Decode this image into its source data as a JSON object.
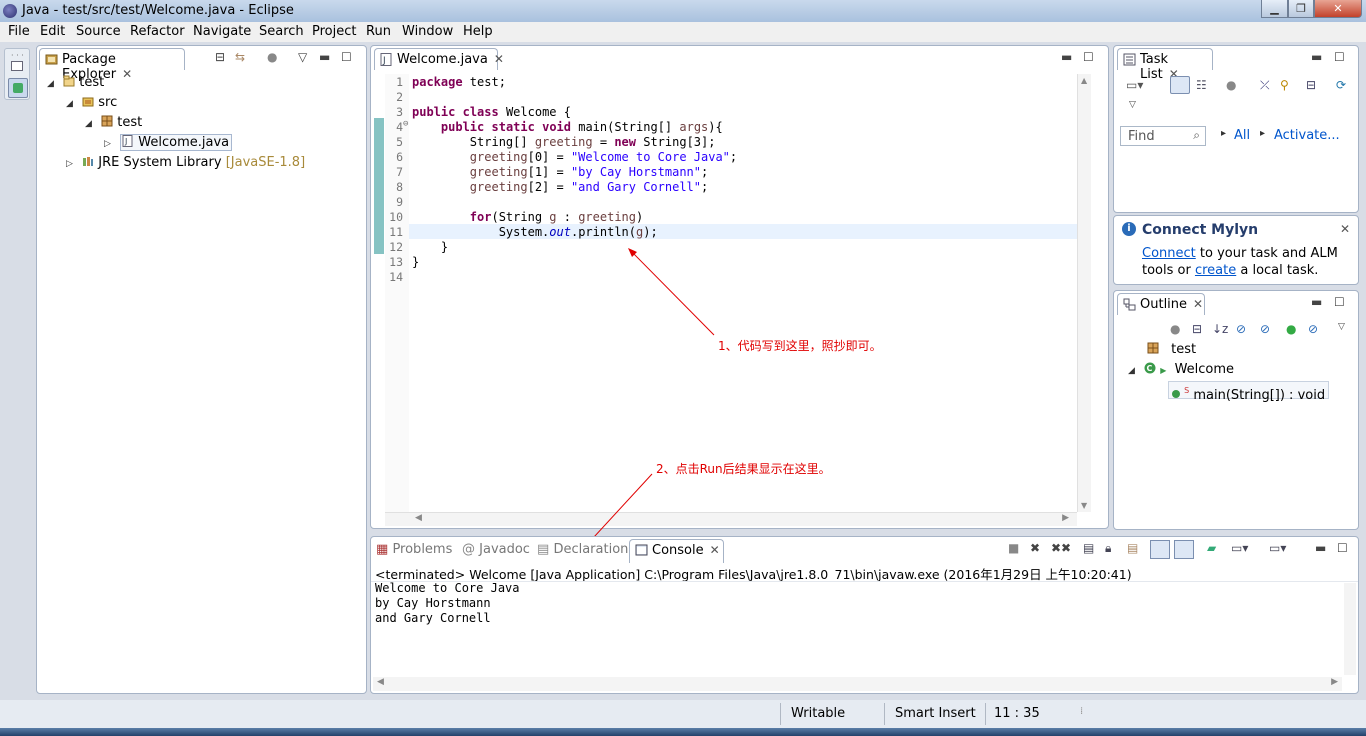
{
  "window": {
    "title": "Java - test/src/test/Welcome.java - Eclipse"
  },
  "menu": [
    "File",
    "Edit",
    "Source",
    "Refactor",
    "Navigate",
    "Search",
    "Project",
    "Run",
    "Window",
    "Help"
  ],
  "package_explorer": {
    "tab_label": "Package Explorer",
    "tree": {
      "project": "test",
      "src": "src",
      "package": "test",
      "file": "Welcome.java",
      "jre": "JRE System Library",
      "jre_version": "[JavaSE-1.8]"
    }
  },
  "editor": {
    "tab_label": "Welcome.java",
    "line_numbers": [
      "1",
      "2",
      "3",
      "4",
      "5",
      "6",
      "7",
      "8",
      "9",
      "10",
      "11",
      "12",
      "13",
      "14"
    ]
  },
  "task_list": {
    "tab_label": "Task List",
    "find_placeholder": "Find",
    "all_label": "All",
    "activate_label": "Activate..."
  },
  "mylyn": {
    "title": "Connect Mylyn",
    "connect_link": "Connect",
    "text1": " to your task and ALM",
    "text2": "tools or ",
    "create_link": "create",
    "text3": " a local task."
  },
  "outline": {
    "tab_label": "Outline",
    "items": [
      "test",
      "Welcome",
      "main(String[]) : void"
    ]
  },
  "console": {
    "tabs": [
      "Problems",
      "Javadoc",
      "Declaration",
      "Console"
    ],
    "header": "<terminated> Welcome [Java Application] C:\\Program Files\\Java\\jre1.8.0_71\\bin\\javaw.exe (2016年1月29日 上午10:20:41)",
    "output": "Welcome to Core Java\nby Cay Horstmann\nand Gary Cornell"
  },
  "annotations": {
    "note1": "1、代码写到这里，照抄即可。",
    "note2": "2、点击Run后结果显示在这里。"
  },
  "status": {
    "writable": "Writable",
    "insert_mode": "Smart Insert",
    "position": "11 : 35"
  },
  "colors": {
    "keyword": "#7f0055",
    "string": "#2a00ff",
    "annotation": "#e00000",
    "link": "#0055cc"
  }
}
